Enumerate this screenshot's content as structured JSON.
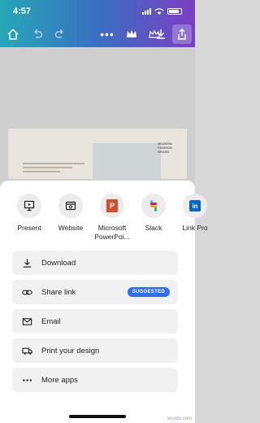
{
  "status_bar": {
    "time": "4:57"
  },
  "toolbar": {
    "icons": [
      "home-icon",
      "undo-icon",
      "redo-icon",
      "more-icon",
      "crown-icon",
      "premium-icon",
      "download-icon",
      "share-icon"
    ]
  },
  "canvas": {
    "design_tag": "MODERN FASHION BRAND"
  },
  "share_sheet": {
    "apps": [
      {
        "label": "Present",
        "icon": "present-icon"
      },
      {
        "label": "Website",
        "icon": "website-icon"
      },
      {
        "label": "Microsoft PowerPoi...",
        "icon": "powerpoint-icon"
      },
      {
        "label": "Slack",
        "icon": "slack-icon"
      },
      {
        "label": "Link Pro",
        "icon": "linkedin-icon"
      }
    ],
    "actions": [
      {
        "label": "Download",
        "icon": "download-icon"
      },
      {
        "label": "Share link",
        "icon": "link-icon",
        "badge": "SUGGESTED"
      },
      {
        "label": "Email",
        "icon": "mail-icon"
      },
      {
        "label": "Print your design",
        "icon": "truck-icon"
      },
      {
        "label": "More apps",
        "icon": "more-icon"
      }
    ]
  },
  "watermark": "wsxdn.com",
  "colors": {
    "header_gradient_start": "#27a7b8",
    "header_gradient_end": "#7a3fc4",
    "badge": "#2f6fec"
  }
}
